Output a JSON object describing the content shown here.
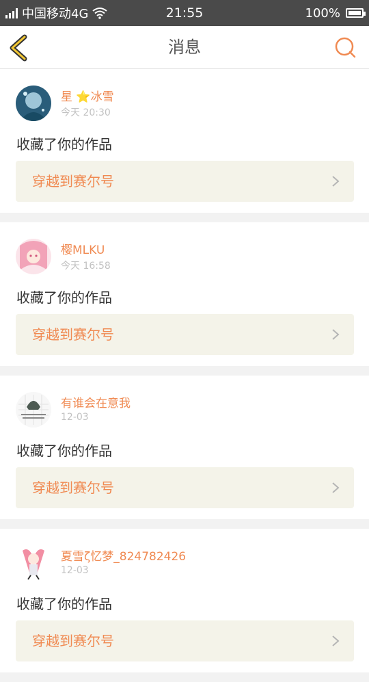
{
  "status_bar": {
    "carrier": "中国移动4G",
    "time": "21:55",
    "battery": "100%",
    "battery_level": 1.0
  },
  "header": {
    "title": "消息",
    "back_icon": "chevron-left-icon",
    "search_icon": "search-icon",
    "accent_color": "#f08a52"
  },
  "messages": [
    {
      "user": "星 ⭐冰雪",
      "time": "今天 20:30",
      "action": "收藏了你的作品",
      "work": "穿越到赛尔号"
    },
    {
      "user": "樱MLKU",
      "time": "今天 16:58",
      "action": "收藏了你的作品",
      "work": "穿越到赛尔号"
    },
    {
      "user": "有谁会在意我",
      "time": "12-03",
      "action": "收藏了你的作品",
      "work": "穿越到赛尔号"
    },
    {
      "user": "夏雪ζ忆梦_824782426",
      "time": "12-03",
      "action": "收藏了你的作品",
      "work": "穿越到赛尔号"
    }
  ]
}
